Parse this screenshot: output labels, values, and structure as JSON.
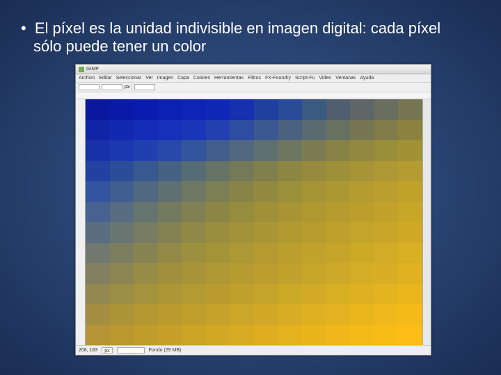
{
  "slide": {
    "bullet": "El píxel es la unidad indivisible en imagen digital: cada píxel sólo puede tener un color"
  },
  "app": {
    "title": "GIMP",
    "menu": [
      "Archivo",
      "Editar",
      "Seleccionar",
      "Ver",
      "Imagen",
      "Capa",
      "Colores",
      "Herramientas",
      "Filtros",
      "FX-Foundry",
      "Script-Fu",
      "Video",
      "Ventanas",
      "Ayuda"
    ],
    "toolbar": {
      "px_x": "",
      "px_y": "",
      "units": "px",
      "zoom": ""
    },
    "status": {
      "coords": "208, 183",
      "units": "px",
      "zoom": "",
      "info": "Fondo (29 MB)"
    }
  },
  "pixel_grid": {
    "cols": 14,
    "rows": 12,
    "colors": [
      "#0a18a0",
      "#0a1aa8",
      "#0a1cb0",
      "#0c20b4",
      "#0e24b6",
      "#1028b8",
      "#1730b0",
      "#2040a0",
      "#2a4c98",
      "#3a5a80",
      "#505e70",
      "#5e6668",
      "#6a6e5e",
      "#767652",
      "#1024a8",
      "#1228b0",
      "#142cb6",
      "#1630ba",
      "#1a36b8",
      "#2240b0",
      "#2e4ca0",
      "#3c5890",
      "#4a6280",
      "#5a6a70",
      "#687060",
      "#767654",
      "#827c4a",
      "#8c8240",
      "#1830a8",
      "#1c38b0",
      "#2040b0",
      "#2848aa",
      "#34549c",
      "#425e8c",
      "#526880",
      "#607070",
      "#6e7660",
      "#7c7c52",
      "#888246",
      "#928840",
      "#9a8e3a",
      "#a29236",
      "#2440a0",
      "#2c4c98",
      "#385890",
      "#466282",
      "#566c74",
      "#667466",
      "#747a58",
      "#80804c",
      "#8c8642",
      "#968a3c",
      "#9e9038",
      "#a69436",
      "#ae9834",
      "#b49c32",
      "#3454a0",
      "#405e90",
      "#506880",
      "#607072",
      "#6e7862",
      "#7c7e54",
      "#888448",
      "#928a40",
      "#9c903a",
      "#a49436",
      "#ac9832",
      "#b49c30",
      "#ba9e2e",
      "#c0a22c",
      "#486290",
      "#566c80",
      "#667470",
      "#747a60",
      "#808052",
      "#8c8646",
      "#968c3e",
      "#a09038",
      "#a89434",
      "#b09830",
      "#b69c2e",
      "#bc9e2c",
      "#c2a22a",
      "#c8a628",
      "#5a6e80",
      "#6a7672",
      "#787c62",
      "#848252",
      "#908846",
      "#9a8e3e",
      "#a29238",
      "#aa9634",
      "#b29a30",
      "#b89c2e",
      "#bea02c",
      "#c4a42a",
      "#caa628",
      "#d0aa26",
      "#707870",
      "#7c7e60",
      "#888452",
      "#928a46",
      "#9c903e",
      "#a49438",
      "#ac9834",
      "#b49a30",
      "#ba9e2e",
      "#c0a22c",
      "#c6a42a",
      "#ccaa28",
      "#d2ac26",
      "#d8b024",
      "#828060",
      "#8c8652",
      "#968c46",
      "#a0903e",
      "#a89438",
      "#b09834",
      "#b69c30",
      "#bc9e2e",
      "#c2a22c",
      "#c8a62a",
      "#cea828",
      "#d4ae26",
      "#daae24",
      "#e0b222",
      "#928850",
      "#9c8e44",
      "#a4923c",
      "#ac9636",
      "#b49a32",
      "#ba9c2e",
      "#c0a02c",
      "#c6a42a",
      "#ccaa28",
      "#d2aa26",
      "#d8b024",
      "#deb022",
      "#e4b420",
      "#eab61e",
      "#a48e42",
      "#ac9438",
      "#b49832",
      "#ba9c2e",
      "#c09e2c",
      "#c6a22a",
      "#cca628",
      "#d2a826",
      "#d8ac24",
      "#deb022",
      "#e4b220",
      "#eab61e",
      "#f0b81c",
      "#f4ba1a",
      "#b49434",
      "#ba982e",
      "#c09c2a",
      "#c6a028",
      "#cca426",
      "#d2a824",
      "#d8aa22",
      "#deae20",
      "#e4b21e",
      "#eab41c",
      "#f0b61a",
      "#f4ba18",
      "#f8bc16",
      "#fcbe14"
    ]
  }
}
